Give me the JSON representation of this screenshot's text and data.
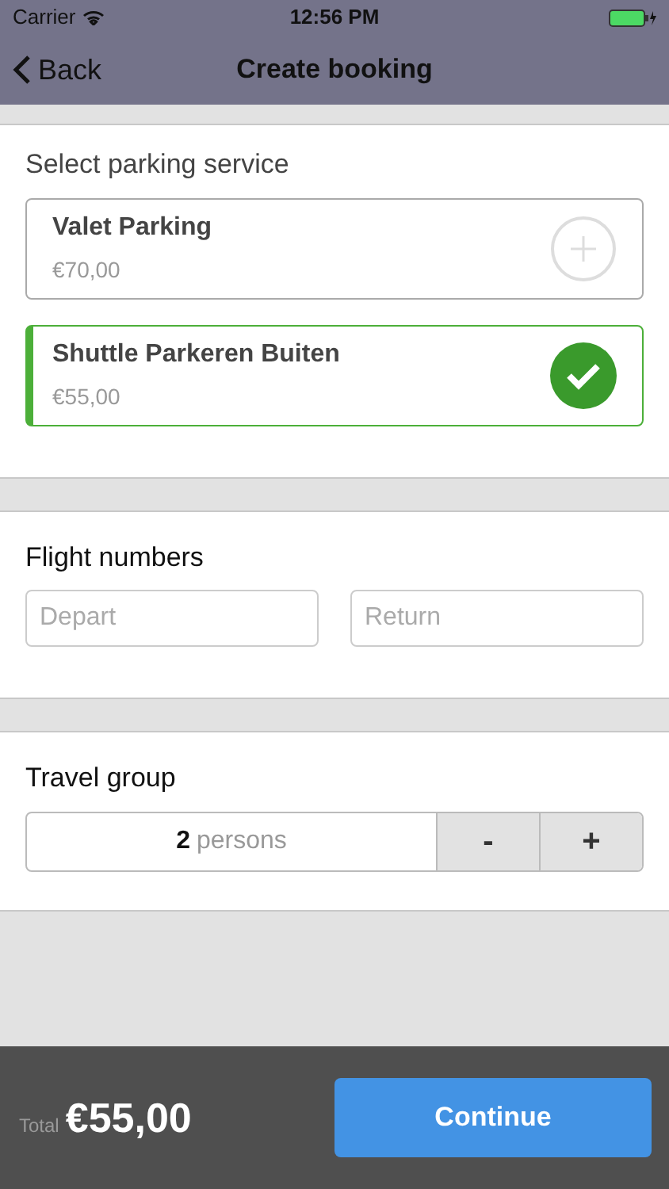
{
  "status_bar": {
    "carrier": "Carrier",
    "time": "12:56 PM"
  },
  "nav": {
    "back": "Back",
    "title": "Create booking"
  },
  "parking": {
    "heading": "Select parking service",
    "services": [
      {
        "name": "Valet Parking",
        "price": "€70,00",
        "selected": false
      },
      {
        "name": "Shuttle Parkeren Buiten",
        "price": "€55,00",
        "selected": true
      }
    ]
  },
  "flights": {
    "heading": "Flight numbers",
    "fields": [
      {
        "placeholder": "Depart"
      },
      {
        "placeholder": "Return"
      }
    ]
  },
  "travel_group": {
    "heading": "Travel group",
    "count": "2",
    "unit": "persons",
    "buttons": [
      "-",
      "+"
    ]
  },
  "footer": {
    "total_label": "Total",
    "total": "€55,00",
    "button": "Continue"
  }
}
